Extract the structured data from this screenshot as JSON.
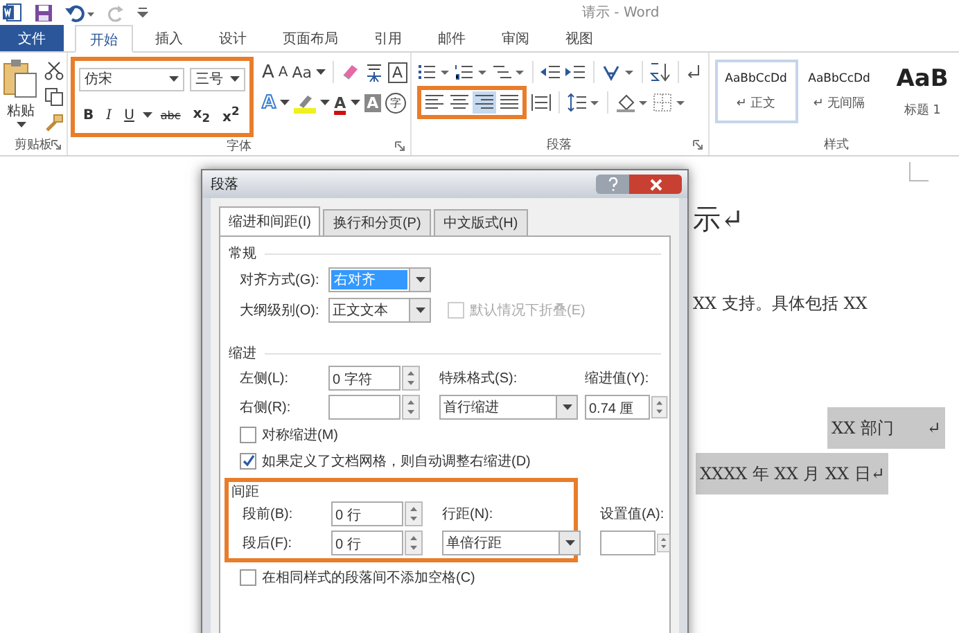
{
  "window": {
    "title": "请示 - Word"
  },
  "tabs": [
    {
      "label": "文件",
      "kind": "file",
      "selected": false
    },
    {
      "label": "开始",
      "kind": "tab",
      "selected": true
    },
    {
      "label": "插入",
      "kind": "tab",
      "selected": false
    },
    {
      "label": "设计",
      "kind": "tab",
      "selected": false
    },
    {
      "label": "页面布局",
      "kind": "tab",
      "selected": false
    },
    {
      "label": "引用",
      "kind": "tab",
      "selected": false
    },
    {
      "label": "邮件",
      "kind": "tab",
      "selected": false
    },
    {
      "label": "审阅",
      "kind": "tab",
      "selected": false
    },
    {
      "label": "视图",
      "kind": "tab",
      "selected": false
    }
  ],
  "clipboard": {
    "paste_label": "粘贴",
    "group_label": "剪贴板"
  },
  "font": {
    "highlighted": true,
    "font_name": "仿宋",
    "font_size": "三号",
    "format_buttons": [
      {
        "kind": "bold",
        "label": "B"
      },
      {
        "kind": "italic",
        "label": "I"
      },
      {
        "kind": "underline",
        "label": "U"
      },
      {
        "kind": "strike",
        "label": "abc"
      },
      {
        "kind": "subscript",
        "label": "x$_{2}$"
      },
      {
        "kind": "superscript",
        "label": "x$^{2}$"
      }
    ],
    "tools_row1": [
      {
        "kind": "grow",
        "label": "A"
      },
      {
        "kind": "shrink",
        "label": "A"
      },
      {
        "kind": "case",
        "label": "Aa"
      },
      {
        "kind": "clear"
      },
      {
        "kind": "phonetic"
      },
      {
        "kind": "border",
        "label": "A"
      }
    ],
    "tools_row2": [
      {
        "kind": "effects",
        "label": "A"
      },
      {
        "kind": "highlight"
      },
      {
        "kind": "color",
        "label": "A"
      },
      {
        "kind": "shading",
        "label": "A"
      },
      {
        "kind": "enclose",
        "label": "字"
      }
    ],
    "group_label": "字体"
  },
  "paragraph": {
    "align_highlighted": true,
    "align_buttons": [
      {
        "kind": "left",
        "selected": false
      },
      {
        "kind": "center",
        "selected": false
      },
      {
        "kind": "right",
        "selected": true
      },
      {
        "kind": "justify",
        "selected": false
      }
    ],
    "group_label": "段落"
  },
  "styles": {
    "items": [
      {
        "preview": "AaBbCcDd",
        "name": "↵ 正文",
        "kind": "body",
        "selected": true
      },
      {
        "preview": "AaBbCcDd",
        "name": "↵ 无间隔",
        "kind": "body",
        "selected": false
      },
      {
        "preview": "AaB",
        "name": "标题 1",
        "kind": "heading",
        "selected": false
      }
    ],
    "group_label": "样式"
  },
  "document": {
    "lines": [
      {
        "text": "示↵",
        "kind": "heading",
        "highlighted": false
      },
      {
        "text": "XX 支持。具体包括 XX",
        "kind": "body",
        "highlighted": false
      },
      {
        "text": "XX 部门　　↵",
        "kind": "signature",
        "highlighted": true
      },
      {
        "text": "XXXX 年 XX 月 XX 日↵",
        "kind": "date",
        "highlighted": true
      }
    ]
  },
  "dialog": {
    "title": "段落",
    "tabs": [
      {
        "label": "缩进和间距(I)",
        "selected": true
      },
      {
        "label": "换行和分页(P)",
        "selected": false
      },
      {
        "label": "中文版式(H)",
        "selected": false
      }
    ],
    "general": {
      "heading": "常规",
      "alignment": {
        "label": "对齐方式(G):",
        "value": "右对齐",
        "focused": true
      },
      "outline": {
        "label": "大纲级别(O):",
        "value": "正文文本"
      },
      "collapse": {
        "label": "默认情况下折叠(E)",
        "checked": false,
        "disabled": true
      }
    },
    "indent": {
      "heading": "缩进",
      "left": {
        "label": "左侧(L):",
        "value": "0 字符"
      },
      "right": {
        "label": "右侧(R):"
      },
      "special": {
        "label": "特殊格式(S):",
        "value": "首行缩进"
      },
      "by": {
        "label": "缩进值(Y):",
        "value": "0.74 厘"
      },
      "mirror": {
        "label": "对称缩进(M)",
        "checked": false,
        "disabled": false
      },
      "grid": {
        "label": "如果定义了文档网格，则自动调整右缩进(D)",
        "checked": true,
        "disabled": false
      }
    },
    "spacing": {
      "heading": "间距",
      "highlighted": true,
      "before": {
        "label": "段前(B):",
        "value": "0 行"
      },
      "after": {
        "label": "段后(F):",
        "value": "0 行"
      },
      "line_spacing": {
        "label": "行距(N):",
        "value": "单倍行距"
      },
      "at": {
        "label": "设置值(A):"
      },
      "no_space": {
        "label": "在相同样式的段落间不添加空格(C)",
        "checked": false,
        "disabled": false
      }
    }
  }
}
